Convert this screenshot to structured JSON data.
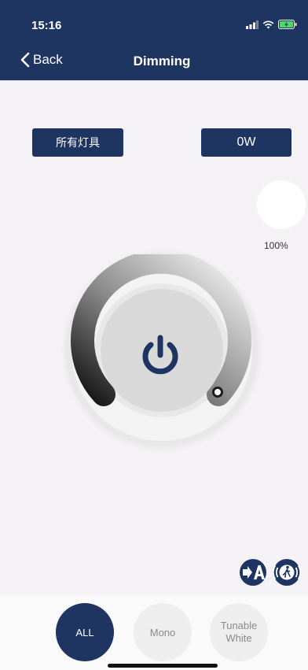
{
  "status": {
    "time": "15:16"
  },
  "nav": {
    "back_label": "Back",
    "title": "Dimming"
  },
  "controls": {
    "fixture_group_label": "所有灯具",
    "power_reading": "0W",
    "brightness_percent": "100%"
  },
  "dial": {
    "level_fraction": 1.0
  },
  "tabs": [
    {
      "label": "ALL",
      "selected": true
    },
    {
      "label": "Mono",
      "selected": false
    },
    {
      "label": "Tunable\nWhite",
      "selected": false
    }
  ],
  "colors": {
    "primary": "#1e3461",
    "background": "#f4f2f4",
    "tab_inactive": "#eeeeee"
  },
  "icons": [
    "signal-icon",
    "wifi-icon",
    "battery-icon",
    "chevron-left-icon",
    "power-icon",
    "auto-mode-icon",
    "motion-sensor-icon"
  ]
}
